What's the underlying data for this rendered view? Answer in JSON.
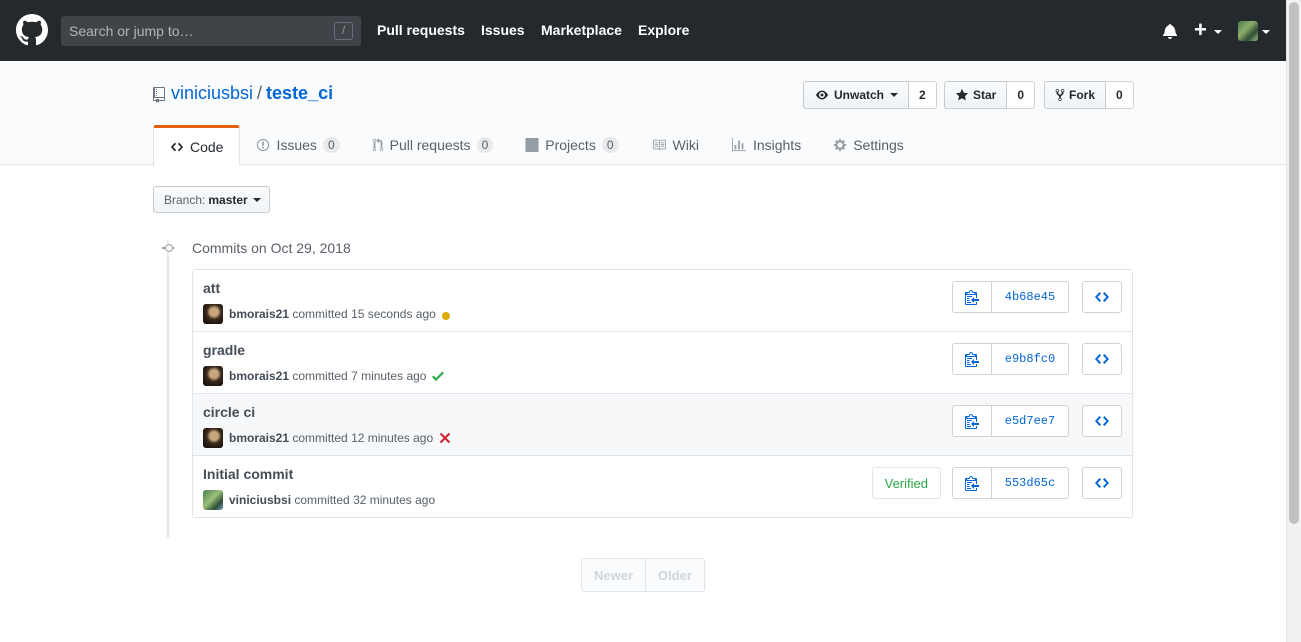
{
  "header": {
    "search_placeholder": "Search or jump to…",
    "search_shortcut": "/",
    "nav": [
      "Pull requests",
      "Issues",
      "Marketplace",
      "Explore"
    ],
    "new_menu_label": "+"
  },
  "repo": {
    "owner": "viniciusbsi",
    "separator": "/",
    "name": "teste_ci",
    "actions": {
      "watch": {
        "label": "Unwatch",
        "count": "2"
      },
      "star": {
        "label": "Star",
        "count": "0"
      },
      "fork": {
        "label": "Fork",
        "count": "0"
      }
    },
    "tabs": [
      {
        "label": "Code",
        "counter": null,
        "icon": "code-icon"
      },
      {
        "label": "Issues",
        "counter": "0",
        "icon": "issue-icon"
      },
      {
        "label": "Pull requests",
        "counter": "0",
        "icon": "pull-request-icon"
      },
      {
        "label": "Projects",
        "counter": "0",
        "icon": "project-icon"
      },
      {
        "label": "Wiki",
        "counter": null,
        "icon": "book-icon"
      },
      {
        "label": "Insights",
        "counter": null,
        "icon": "graph-icon"
      },
      {
        "label": "Settings",
        "counter": null,
        "icon": "gear-icon"
      }
    ]
  },
  "branch": {
    "label": "Branch:",
    "value": "master"
  },
  "commits_date": "Commits on Oct 29, 2018",
  "commits": [
    {
      "title": "att",
      "author": "bmorais21",
      "action": "committed",
      "time": "15 seconds ago",
      "status": "pending",
      "sha": "4b68e45",
      "verified": null
    },
    {
      "title": "gradle",
      "author": "bmorais21",
      "action": "committed",
      "time": "7 minutes ago",
      "status": "success",
      "sha": "e9b8fc0",
      "verified": null
    },
    {
      "title": "circle ci",
      "author": "bmorais21",
      "action": "committed",
      "time": "12 minutes ago",
      "status": "failure",
      "sha": "e5d7ee7",
      "verified": null
    },
    {
      "title": "Initial commit",
      "author": "viniciusbsi",
      "action": "committed",
      "time": "32 minutes ago",
      "status": null,
      "sha": "553d65c",
      "verified": "Verified"
    }
  ],
  "pagination": {
    "newer": "Newer",
    "older": "Older"
  },
  "colors": {
    "pending": "#dbab09",
    "success": "#28a745",
    "failure": "#cb2431",
    "link": "#0366d6",
    "selected_tab_border": "#e36209"
  }
}
